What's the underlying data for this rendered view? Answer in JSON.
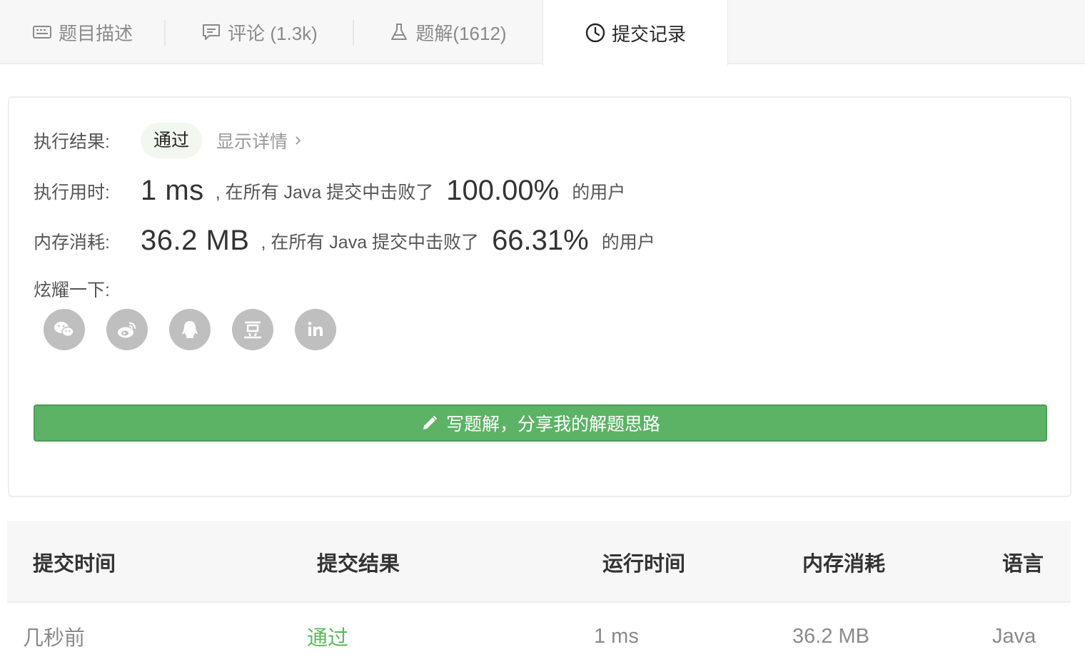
{
  "tabs": [
    {
      "label": "题目描述",
      "icon": "description-icon"
    },
    {
      "label": "评论 (1.3k)",
      "icon": "comment-icon"
    },
    {
      "label": "题解(1612)",
      "icon": "flask-icon"
    },
    {
      "label": "提交记录",
      "icon": "clock-icon",
      "active": true
    }
  ],
  "result": {
    "status_label": "执行结果:",
    "status_value": "通过",
    "show_detail": "显示详情",
    "runtime_label": "执行用时:",
    "runtime_value": "1 ms",
    "runtime_mid": ", 在所有 Java 提交中击败了",
    "runtime_pct": "100.00%",
    "runtime_tail": "的用户",
    "memory_label": "内存消耗:",
    "memory_value": "36.2 MB",
    "memory_mid": ", 在所有 Java 提交中击败了",
    "memory_pct": "66.31%",
    "memory_tail": "的用户",
    "share_label": "炫耀一下:",
    "share_targets": [
      "wechat-icon",
      "weibo-icon",
      "qq-icon",
      "douban-icon",
      "linkedin-icon"
    ],
    "write_button": "写题解，分享我的解题思路"
  },
  "table": {
    "headers": [
      "提交时间",
      "提交结果",
      "运行时间",
      "内存消耗",
      "语言"
    ],
    "rows": [
      [
        "几秒前",
        "通过",
        "1 ms",
        "36.2 MB",
        "Java"
      ]
    ]
  },
  "colors": {
    "accent_green": "#5cb365",
    "success_text": "#5cb85c",
    "share_gray": "#bfbfbf"
  }
}
